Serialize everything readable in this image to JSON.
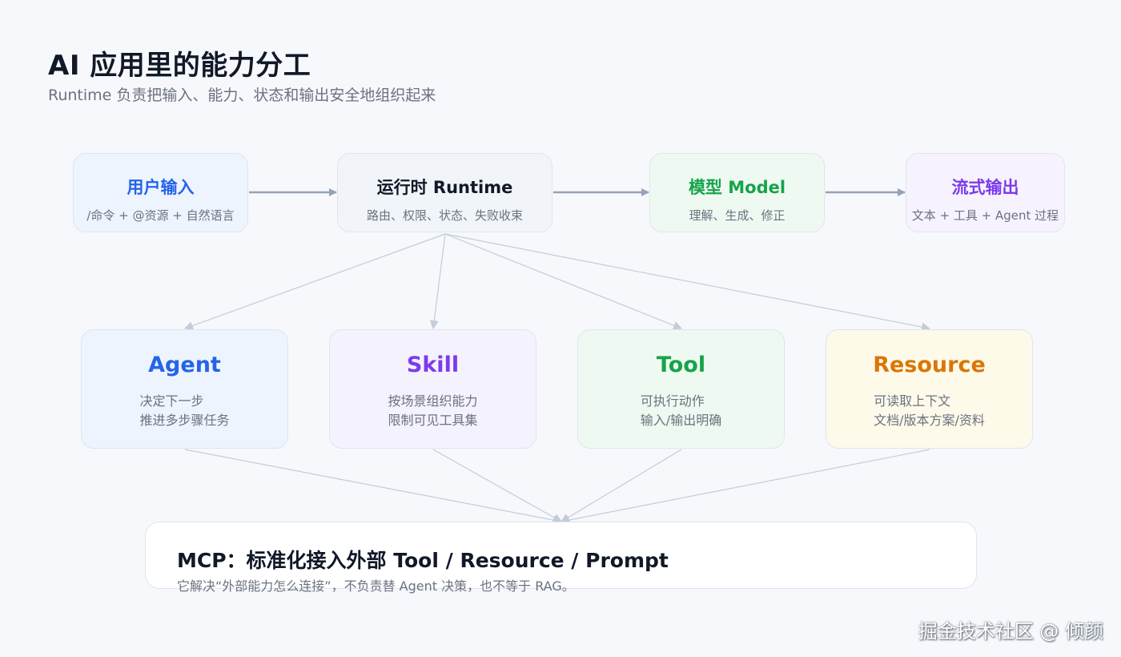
{
  "header": {
    "title": "AI 应用里的能力分工",
    "subtitle": "Runtime 负责把输入、能力、状态和输出安全地组织起来"
  },
  "flow": {
    "input": {
      "name": "用户输入",
      "desc": "/命令 + @资源 + 自然语言"
    },
    "runtime": {
      "name": "运行时 Runtime",
      "desc": "路由、权限、状态、失败收束"
    },
    "model": {
      "name": "模型 Model",
      "desc": "理解、生成、修正"
    },
    "output": {
      "name": "流式输出",
      "desc": "文本 + 工具 + Agent 过程"
    }
  },
  "capabilities": {
    "agent": {
      "name": "Agent",
      "line1": "决定下一步",
      "line2": "推进多步骤任务"
    },
    "skill": {
      "name": "Skill",
      "line1": "按场景组织能力",
      "line2": "限制可见工具集"
    },
    "tool": {
      "name": "Tool",
      "line1": "可执行动作",
      "line2": "输入/输出明确"
    },
    "resource": {
      "name": "Resource",
      "line1": "可读取上下文",
      "line2": "文档/版本方案/资料"
    }
  },
  "mcp": {
    "name": "MCP：标准化接入外部 Tool / Resource / Prompt",
    "desc": "它解决“外部能力怎么连接”，不负责替 Agent 决策，也不等于 RAG。"
  },
  "watermark": "掘金技术社区 @ 倾颜",
  "colors": {
    "blue": "#2563eb",
    "purple": "#7c3aed",
    "green": "#16a34a",
    "orange": "#d97706",
    "arrow": "#94a3b8"
  }
}
